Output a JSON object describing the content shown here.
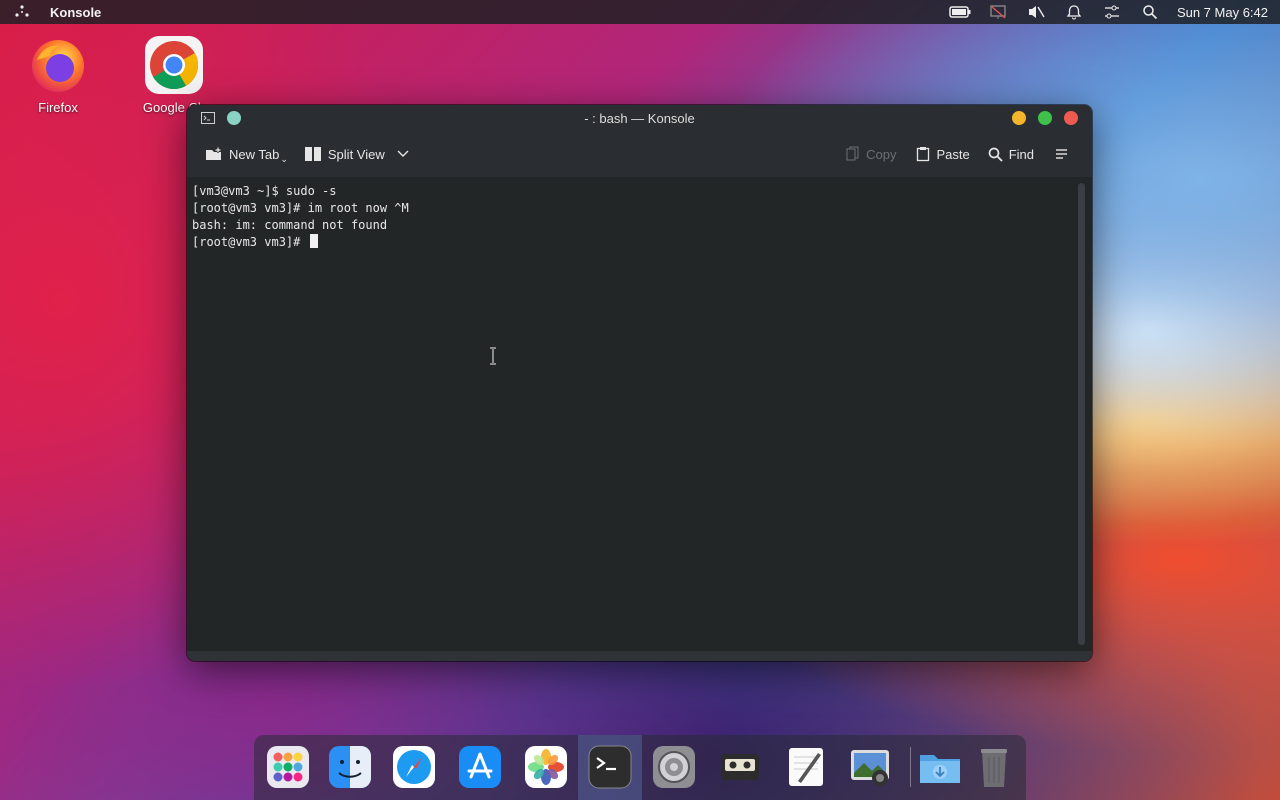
{
  "topbar": {
    "app_name": "Konsole",
    "clock": "Sun 7 May  6:42",
    "tray_icons": [
      "battery-icon",
      "network-icon",
      "volume-muted-icon",
      "notifications-icon",
      "settings-sliders-icon",
      "search-icon"
    ]
  },
  "desktop": {
    "icons": [
      {
        "label": "Firefox",
        "icon": "firefox-icon"
      },
      {
        "label": "Google Ch",
        "icon": "chrome-icon"
      }
    ]
  },
  "window": {
    "title": "- : bash — Konsole",
    "toolbar": {
      "new_tab": "New Tab",
      "split_view": "Split View",
      "copy": "Copy",
      "paste": "Paste",
      "find": "Find"
    },
    "terminal": {
      "lines": [
        "[vm3@vm3 ~]$ sudo -s",
        "[root@vm3 vm3]# im root now ^M",
        "bash: im: command not found",
        "[root@vm3 vm3]# "
      ]
    }
  },
  "dock": {
    "items": [
      "launchpad-icon",
      "finder-icon",
      "safari-icon",
      "app-store-icon",
      "photos-icon",
      "terminal-icon",
      "system-settings-icon",
      "cassette-player-icon",
      "text-editor-icon",
      "screenshot-icon",
      "downloads-folder-icon",
      "trash-icon"
    ],
    "active": "terminal-icon"
  }
}
